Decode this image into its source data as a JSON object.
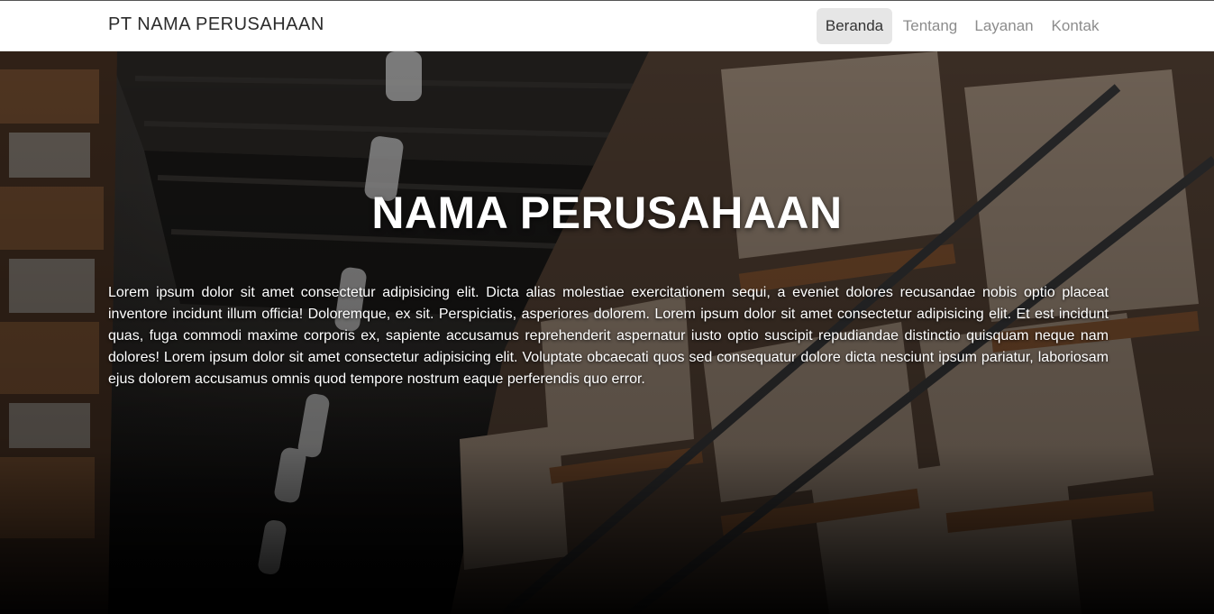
{
  "navbar": {
    "brand": "PT NAMA PERUSAHAAN",
    "items": [
      {
        "label": "Beranda",
        "active": true
      },
      {
        "label": "Tentang",
        "active": false
      },
      {
        "label": "Layanan",
        "active": false
      },
      {
        "label": "Kontak",
        "active": false
      }
    ]
  },
  "hero": {
    "title": "NAMA PERUSAHAAN",
    "paragraph": "Lorem ipsum dolor sit amet consectetur adipisicing elit. Dicta alias molestiae exercitationem sequi, a eveniet dolores recusandae nobis optio placeat inventore incidunt illum officia! Doloremque, ex sit. Perspiciatis, asperiores dolorem. Lorem ipsum dolor sit amet consectetur adipisicing elit. Et est incidunt quas, fuga commodi maxime corporis ex, sapiente accusamus reprehenderit aspernatur iusto optio suscipit repudiandae distinctio quisquam neque nam dolores! Lorem ipsum dolor sit amet consectetur adipisicing elit. Voluptate obcaecati quos sed consequatur dolore dicta nesciunt ipsum pariatur, laboriosam ejus dolorem accusamus omnis quod tempore nostrum eaque perferendis quo error."
  },
  "colors": {
    "navbar_bg": "#ffffff",
    "active_item_bg": "#e6e6e6",
    "nav_text": "#8c8c8c",
    "hero_text": "#ffffff"
  }
}
